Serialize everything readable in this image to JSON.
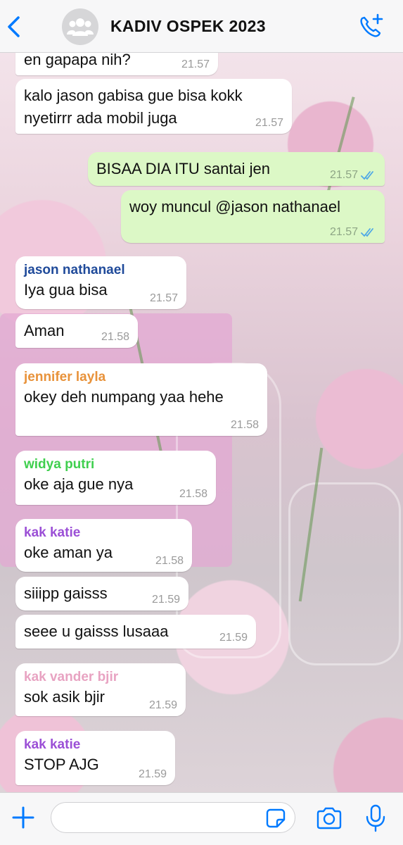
{
  "header": {
    "title": "KADIV OSPEK 2023",
    "avatar_icon": "group-avatar-icon",
    "back_icon": "chevron-left-icon",
    "call_icon": "add-call-icon"
  },
  "colors": {
    "accent": "#007aff",
    "outgoing_bubble": "#dcf8c6",
    "incoming_bubble": "#ffffff",
    "read_tick": "#4fa8e6"
  },
  "messages": [
    {
      "direction": "in",
      "sender": "",
      "text": "en gapapa nih?",
      "time": "21.57"
    },
    {
      "direction": "in",
      "sender": "",
      "text": "kalo jason gabisa gue bisa kokk\nnyetirrr ada mobil juga",
      "time": "21.57"
    },
    {
      "direction": "out",
      "sender": "",
      "text": "BISAA DIA ITU santai jen",
      "time": "21.57",
      "status": "read"
    },
    {
      "direction": "out",
      "sender": "",
      "text": "woy muncul @jason nathanael",
      "time": "21.57",
      "status": "read"
    },
    {
      "direction": "in",
      "sender": "jason nathanael",
      "sender_color": "#1f4a9a",
      "text": "Iya gua bisa",
      "time": "21.57"
    },
    {
      "direction": "in",
      "sender": "",
      "text": "Aman",
      "time": "21.58"
    },
    {
      "direction": "in",
      "sender": "jennifer layla",
      "sender_color": "#e8923a",
      "text": "okey deh numpang yaa hehe",
      "time": "21.58"
    },
    {
      "direction": "in",
      "sender": "widya putri",
      "sender_color": "#3fcf4e",
      "text": "oke aja gue nya",
      "time": "21.58"
    },
    {
      "direction": "in",
      "sender": "kak katie",
      "sender_color": "#9b4fd6",
      "text": "oke aman ya",
      "time": "21.58"
    },
    {
      "direction": "in",
      "sender": "",
      "text": "siiipp gaisss",
      "time": "21.59"
    },
    {
      "direction": "in",
      "sender": "",
      "text": "seee u gaisss lusaaa",
      "time": "21.59"
    },
    {
      "direction": "in",
      "sender": "kak vander bjir",
      "sender_color": "#e8a3c2",
      "text": "sok asik bjir",
      "time": "21.59"
    },
    {
      "direction": "in",
      "sender": "kak katie",
      "sender_color": "#9b4fd6",
      "text": "STOP AJG",
      "time": "21.59"
    }
  ],
  "input_bar": {
    "placeholder": "",
    "plus_icon": "plus-icon",
    "sticker_icon": "sticker-icon",
    "camera_icon": "camera-icon",
    "mic_icon": "microphone-icon"
  }
}
